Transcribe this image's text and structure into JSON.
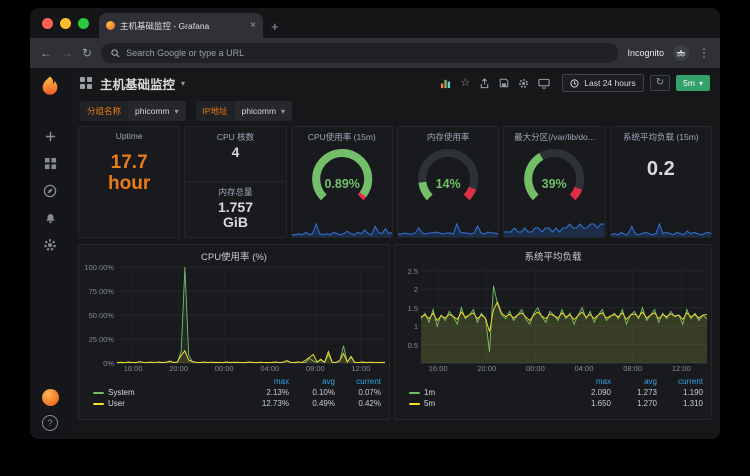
{
  "browser": {
    "tab_title": "主机基础监控 - Grafana",
    "address_placeholder": "Search Google or type a URL",
    "incognito_label": "Incognito"
  },
  "icons": {
    "back": "←",
    "forward": "→",
    "reload": "↻",
    "menu": "⋮",
    "caret": "▾",
    "star": "☆",
    "tab_close": "×",
    "new_tab": "+",
    "help": "?"
  },
  "nav": {
    "title": "主机基础监控",
    "time_range_label": "Last 24 hours",
    "refresh_interval": "5m"
  },
  "variables": [
    {
      "label": "分组名称",
      "value": "phicomm"
    },
    {
      "label": "IP地址",
      "value": "phicomm"
    }
  ],
  "stats": {
    "uptime": {
      "title": "Uptime",
      "value_line1": "17.7",
      "value_line2": "hour"
    },
    "cpu_cores": {
      "title": "CPU 核数",
      "value": "4"
    },
    "memory_total": {
      "title": "内存总量",
      "value_line1": "1.757",
      "value_line2": "GiB"
    },
    "load15": {
      "title": "系统平均负载 (15m)",
      "value": "0.2",
      "spark": [
        1,
        2,
        1,
        3,
        1,
        2,
        8,
        2,
        1,
        2,
        3,
        2,
        1,
        2,
        10,
        2,
        3,
        2,
        1,
        3,
        2,
        1,
        4,
        2,
        3,
        2,
        1,
        2,
        3,
        2
      ]
    }
  },
  "gauges": [
    {
      "title": "CPU使用率 (15m)",
      "value": "0.89%",
      "fraction": 0.97,
      "spark": [
        1,
        1,
        2,
        1,
        3,
        1,
        2,
        10,
        2,
        1,
        2,
        1,
        3,
        2,
        1,
        2,
        4,
        2,
        1,
        3,
        2,
        5,
        2,
        1,
        8,
        3,
        2,
        6,
        2,
        3
      ]
    },
    {
      "title": "内存使用率",
      "value": "14%",
      "fraction": 0.14,
      "spark": [
        2,
        2,
        3,
        2,
        2,
        3,
        8,
        3,
        2,
        3,
        3,
        4,
        3,
        2,
        3,
        3,
        2,
        12,
        4,
        3,
        3,
        2,
        3,
        10,
        3,
        2,
        4,
        3,
        3,
        2
      ]
    },
    {
      "title": "最大分区(/var/lib/do...",
      "value": "39%",
      "fraction": 0.39,
      "spark": [
        1,
        1,
        1,
        2,
        1,
        1,
        2,
        1,
        1,
        2,
        2,
        1,
        2,
        2,
        1,
        2,
        1,
        2,
        2,
        3,
        2,
        2,
        3,
        2,
        2,
        3,
        3,
        2,
        3,
        3
      ]
    }
  ],
  "chart_data": [
    {
      "type": "line",
      "title": "CPU使用率 (%)",
      "x_ticks": [
        "16:00",
        "20:00",
        "00:00",
        "04:00",
        "08:00",
        "12:00"
      ],
      "x_tick_fracs": [
        0.06,
        0.23,
        0.4,
        0.57,
        0.74,
        0.91
      ],
      "y_tick_labels": [
        "100.00%",
        "75.00%",
        "50.00%",
        "25.00%",
        "0%"
      ],
      "y_tick_values": [
        100,
        75,
        50,
        25,
        0
      ],
      "ylim": [
        0,
        100
      ],
      "legend_position": "bottom",
      "grid": true,
      "legend_columns": [
        "max",
        "avg",
        "current"
      ],
      "series": [
        {
          "name": "System",
          "color": "#73bf69",
          "stats": [
            "2.13%",
            "0.10%",
            "0.07%"
          ],
          "values": [
            0.3,
            0.5,
            0.2,
            0.8,
            0.4,
            0.3,
            1.2,
            0.5,
            0.3,
            0.6,
            0.4,
            0.8,
            0.3,
            0.5,
            1.5,
            0.4,
            0.6,
            12,
            100,
            8,
            1.2,
            0.5,
            0.3,
            0.8,
            0.4,
            0.6,
            0.3,
            0.5,
            0.4,
            0.8,
            0.3,
            0.6,
            0.5,
            0.4,
            0.3,
            0.8,
            0.5,
            0.3,
            0.6,
            0.4,
            0.3,
            0.5,
            0.8,
            0.4,
            0.6,
            2.1,
            0.5,
            0.3,
            0.8,
            0.4,
            0.6,
            5,
            2,
            0.8,
            3,
            0.5,
            9,
            0.6,
            0.4,
            2,
            18,
            0.8,
            6,
            0.5,
            0.4,
            0.8,
            0.3,
            0.6,
            0.5,
            0.4,
            0.3,
            0.5
          ]
        },
        {
          "name": "User",
          "color": "#fade2a",
          "stats": [
            "12.73%",
            "0.49%",
            "0.42%"
          ],
          "values": [
            0.5,
            0.8,
            0.4,
            1.0,
            0.6,
            0.5,
            1.5,
            0.7,
            0.5,
            0.9,
            0.6,
            1.0,
            0.5,
            0.8,
            2.0,
            0.6,
            0.9,
            8,
            12.7,
            3,
            1.5,
            0.7,
            0.5,
            1.0,
            0.6,
            0.8,
            0.5,
            0.7,
            0.6,
            1.0,
            0.5,
            0.8,
            0.7,
            0.6,
            0.5,
            1.0,
            0.7,
            0.5,
            0.8,
            0.6,
            0.5,
            0.7,
            1.0,
            0.6,
            0.8,
            2.5,
            0.7,
            0.5,
            1.0,
            0.6,
            3,
            6,
            9,
            1.0,
            4,
            0.7,
            12,
            0.8,
            0.6,
            2.5,
            10,
            1.0,
            7,
            0.7,
            0.6,
            1.0,
            0.5,
            0.8,
            0.7,
            0.6,
            0.5,
            0.7
          ]
        }
      ]
    },
    {
      "type": "line",
      "title": "系统平均负载",
      "x_ticks": [
        "16:00",
        "20:00",
        "00:00",
        "04:00",
        "08:00",
        "12:00"
      ],
      "x_tick_fracs": [
        0.06,
        0.23,
        0.4,
        0.57,
        0.74,
        0.91
      ],
      "y_tick_labels": [
        "2.5",
        "2",
        "1.5",
        "1",
        "0.5"
      ],
      "y_tick_values": [
        2.5,
        2,
        1.5,
        1,
        0.5
      ],
      "ylim": [
        0,
        2.6
      ],
      "legend_position": "bottom",
      "grid": true,
      "legend_columns": [
        "max",
        "avg",
        "current"
      ],
      "series": [
        {
          "name": "1m",
          "color": "#73bf69",
          "stats": [
            "2.090",
            "1.273",
            "1.190"
          ],
          "values": [
            1.2,
            1.35,
            1.1,
            1.45,
            1.0,
            1.3,
            1.15,
            1.4,
            1.25,
            1.05,
            1.5,
            1.2,
            1.3,
            1.45,
            1.1,
            1.35,
            1.2,
            0.3,
            2.09,
            1.6,
            1.3,
            1.2,
            1.4,
            1.15,
            1.3,
            1.45,
            1.2,
            1.05,
            1.35,
            1.5,
            1.25,
            1.1,
            1.4,
            1.3,
            1.15,
            1.45,
            1.2,
            1.35,
            1.05,
            1.3,
            1.5,
            1.2,
            1.4,
            1.1,
            1.3,
            1.45,
            1.15,
            1.25,
            1.35,
            1.2,
            1.45,
            1.05,
            1.3,
            1.4,
            1.2,
            1.5,
            1.15,
            1.3,
            1.45,
            1.1,
            1.35,
            1.2,
            1.4,
            1.25,
            1.3,
            1.05,
            1.45,
            1.2,
            1.35,
            1.15,
            1.3,
            1.19
          ]
        },
        {
          "name": "5m",
          "color": "#fade2a",
          "stats": [
            "1.650",
            "1.270",
            "1.310"
          ],
          "values": [
            1.25,
            1.3,
            1.2,
            1.35,
            1.15,
            1.28,
            1.22,
            1.32,
            1.26,
            1.18,
            1.38,
            1.24,
            1.3,
            1.36,
            1.2,
            1.3,
            1.22,
            0.85,
            1.45,
            1.65,
            1.35,
            1.26,
            1.32,
            1.22,
            1.3,
            1.36,
            1.25,
            1.15,
            1.3,
            1.38,
            1.27,
            1.2,
            1.33,
            1.28,
            1.22,
            1.36,
            1.25,
            1.3,
            1.18,
            1.28,
            1.38,
            1.24,
            1.32,
            1.2,
            1.3,
            1.36,
            1.22,
            1.27,
            1.31,
            1.25,
            1.36,
            1.18,
            1.3,
            1.33,
            1.24,
            1.38,
            1.22,
            1.3,
            1.36,
            1.2,
            1.31,
            1.25,
            1.33,
            1.27,
            1.3,
            1.18,
            1.36,
            1.25,
            1.31,
            1.22,
            1.3,
            1.31
          ]
        }
      ]
    }
  ],
  "colors": {
    "accent_orange": "#eb7b18",
    "series_green": "#73bf69",
    "series_yellow": "#fade2a",
    "spark_blue": "#3274d9",
    "legend_header_blue": "#33a2e5",
    "gauge_red": "#e02f44",
    "interval_green": "#34a06a"
  }
}
